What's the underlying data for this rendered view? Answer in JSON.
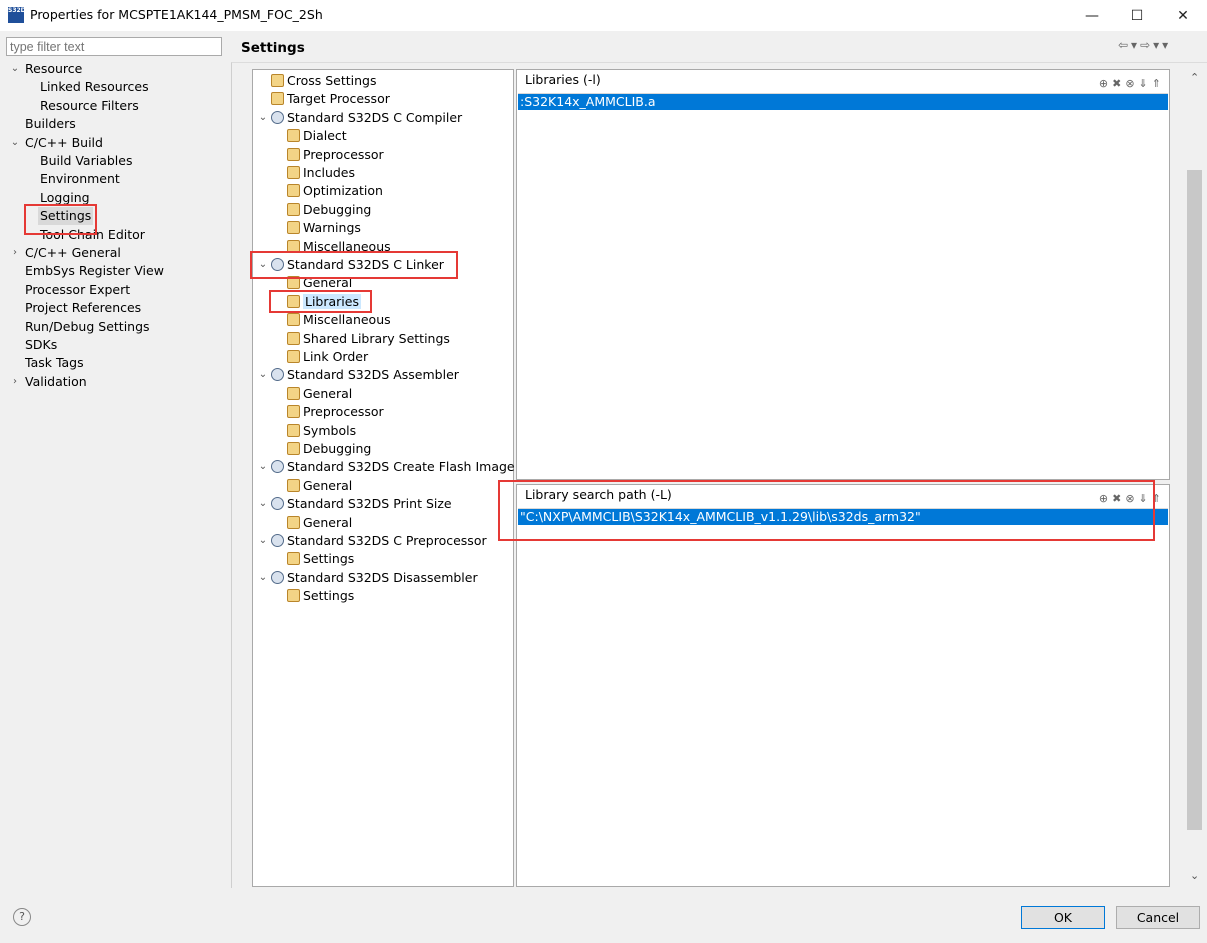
{
  "window": {
    "icon_text": "S32DS",
    "title": "Properties for MCSPTE1AK144_PMSM_FOC_2Sh",
    "minimize": "—",
    "maximize": "☐",
    "close": "✕"
  },
  "filter": {
    "placeholder": "type filter text"
  },
  "left_tree": [
    {
      "label": "Resource",
      "chevron": "⌄"
    },
    {
      "label": "Linked Resources"
    },
    {
      "label": "Resource Filters"
    },
    {
      "label": "Builders"
    },
    {
      "label": "C/C++ Build",
      "chevron": "⌄"
    },
    {
      "label": "Build Variables"
    },
    {
      "label": "Environment"
    },
    {
      "label": "Logging"
    },
    {
      "label": "Settings",
      "selected": true
    },
    {
      "label": "Tool Chain Editor"
    },
    {
      "label": "C/C++ General",
      "chevron": "›"
    },
    {
      "label": "EmbSys Register View"
    },
    {
      "label": "Processor Expert"
    },
    {
      "label": "Project References"
    },
    {
      "label": "Run/Debug Settings"
    },
    {
      "label": "SDKs"
    },
    {
      "label": "Task Tags"
    },
    {
      "label": "Validation",
      "chevron": "›"
    }
  ],
  "settings": {
    "title": "Settings",
    "nav_arrows": "⇦▾⇨▾▾"
  },
  "mid_tree": [
    {
      "label": "Cross Settings"
    },
    {
      "label": "Target Processor"
    },
    {
      "label": "Standard S32DS C Compiler",
      "chevron": "⌄"
    },
    {
      "label": "Dialect"
    },
    {
      "label": "Preprocessor"
    },
    {
      "label": "Includes"
    },
    {
      "label": "Optimization"
    },
    {
      "label": "Debugging"
    },
    {
      "label": "Warnings"
    },
    {
      "label": "Miscellaneous"
    },
    {
      "label": "Standard S32DS C Linker",
      "chevron": "⌄"
    },
    {
      "label": "General"
    },
    {
      "label": "Libraries",
      "selected": true
    },
    {
      "label": "Miscellaneous"
    },
    {
      "label": "Shared Library Settings"
    },
    {
      "label": "Link Order"
    },
    {
      "label": "Standard S32DS Assembler",
      "chevron": "⌄"
    },
    {
      "label": "General"
    },
    {
      "label": "Preprocessor"
    },
    {
      "label": "Symbols"
    },
    {
      "label": "Debugging"
    },
    {
      "label": "Standard S32DS Create Flash Image",
      "chevron": "⌄"
    },
    {
      "label": "General"
    },
    {
      "label": "Standard S32DS Print Size",
      "chevron": "⌄"
    },
    {
      "label": "General"
    },
    {
      "label": "Standard S32DS C Preprocessor",
      "chevron": "⌄"
    },
    {
      "label": "Settings"
    },
    {
      "label": "Standard S32DS Disassembler",
      "chevron": "⌄"
    },
    {
      "label": "Settings"
    }
  ],
  "libraries_panel": {
    "title": "Libraries (-l)",
    "tool_icons": "⊕✖⊗⇓⇑",
    "items": [
      ":S32K14x_AMMCLIB.a"
    ]
  },
  "search_path_panel": {
    "title": "Library search path (-L)",
    "tool_icons": "⊕✖⊗⇓⇑",
    "items": [
      "\"C:\\NXP\\AMMCLIB\\S32K14x_AMMCLIB_v1.1.29\\lib\\s32ds_arm32\""
    ]
  },
  "scrollbar": {
    "up": "⌃",
    "down": "⌄"
  },
  "footer": {
    "help": "?",
    "ok": "OK",
    "cancel": "Cancel"
  },
  "colors": {
    "selection": "#0078d7",
    "highlight": "#e53935",
    "tree_selection": "#cce8ff"
  }
}
